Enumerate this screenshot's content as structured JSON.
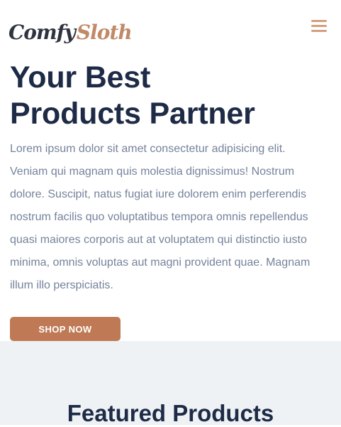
{
  "header": {
    "logo_part_a": "Comfy",
    "logo_part_b": "Sloth",
    "menu_icon": "hamburger-menu-icon",
    "accent_color": "#d2a07f"
  },
  "hero": {
    "title_line_1": "Your Best",
    "title_line_2": "Products Partner",
    "paragraph": "Lorem ipsum dolor sit amet consectetur adipisicing elit. Veniam qui magnam quis molestia dignissimus! Nostrum dolore. Suscipit, natus fugiat iure dolorem enim perferendis nostrum facilis quo voluptatibus tempora omnis repellendus quasi maiores corporis aut at voluptatem qui distinctio iusto minima, omnis voluptas aut magni provident quae. Magnam illum illo perspiciatis.",
    "cta_label": "SHOP NOW",
    "text_color": "#1e2b46",
    "paragraph_color": "#75839b",
    "button_color": "#bf7a55"
  },
  "featured": {
    "title": "Featured Products",
    "background_color": "#eef2f5"
  }
}
